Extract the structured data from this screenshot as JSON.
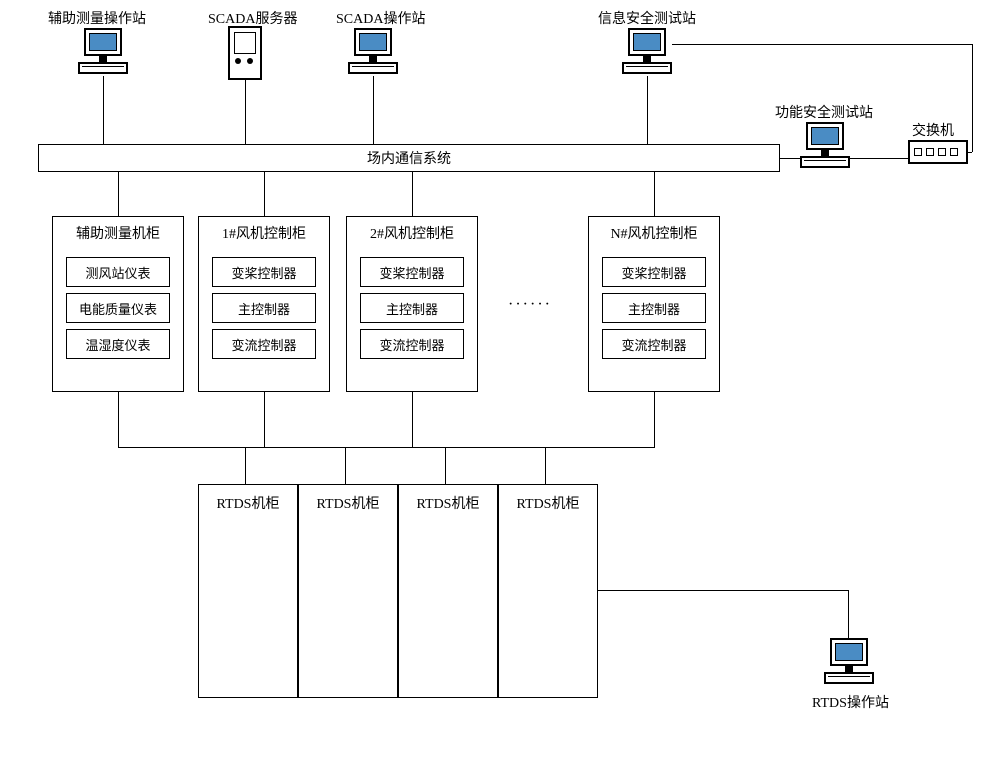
{
  "top": {
    "aux_station": "辅助测量操作站",
    "scada_server": "SCADA服务器",
    "scada_station": "SCADA操作站",
    "info_sec_station": "信息安全测试站",
    "func_safe_station": "功能安全测试站",
    "switch": "交换机"
  },
  "bus": {
    "label": "场内通信系统"
  },
  "cabinets": {
    "aux": {
      "title": "辅助测量机柜",
      "items": [
        "测风站仪表",
        "电能质量仪表",
        "温湿度仪表"
      ]
    },
    "fan1": {
      "title": "1#风机控制柜",
      "items": [
        "变桨控制器",
        "主控制器",
        "变流控制器"
      ]
    },
    "fan2": {
      "title": "2#风机控制柜",
      "items": [
        "变桨控制器",
        "主控制器",
        "变流控制器"
      ]
    },
    "fanN": {
      "title": "N#风机控制柜",
      "items": [
        "变桨控制器",
        "主控制器",
        "变流控制器"
      ]
    }
  },
  "rtds": {
    "cabinet": "RTDS机柜",
    "station": "RTDS操作站"
  }
}
